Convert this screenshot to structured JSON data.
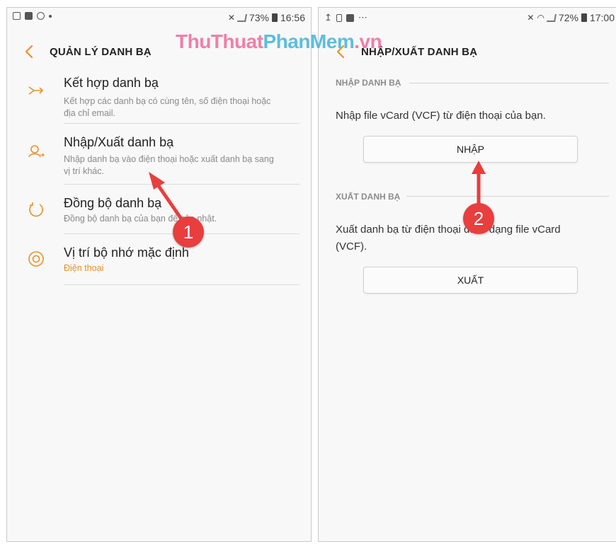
{
  "watermark": {
    "part1": "ThuThuat",
    "part2": "PhanMem",
    "part3": ".vn"
  },
  "left": {
    "status": {
      "battery": "73%",
      "time": "16:56"
    },
    "header": {
      "title": "QUẢN LÝ DANH BẠ",
      "back_icon": "chevron-left-icon"
    },
    "items": [
      {
        "title": "Kết hợp danh bạ",
        "desc": "Kết hợp các danh bạ có cùng tên, số điện thoại hoặc địa chỉ email.",
        "icon": "merge-icon"
      },
      {
        "title": "Nhập/Xuất danh bạ",
        "desc": "Nhập danh bạ vào điện thoại hoặc xuất danh bạ sang vị trí khác.",
        "icon": "import-export-icon"
      },
      {
        "title": "Đồng bộ danh bạ",
        "desc": "Đồng bộ danh bạ của bạn để cập nhật.",
        "icon": "sync-icon"
      },
      {
        "title": "Vị trí bộ nhớ mặc định",
        "desc": "Điện thoại",
        "icon": "storage-icon"
      }
    ]
  },
  "right": {
    "status": {
      "battery": "72%",
      "time": "17:00"
    },
    "header": {
      "title": "NHẬP/XUẤT DANH BẠ"
    },
    "import_section": {
      "label": "NHẬP DANH BẠ",
      "text": "Nhập file vCard (VCF) từ điện thoại của bạn.",
      "button": "NHẬP"
    },
    "export_section": {
      "label": "XUẤT DANH BẠ",
      "text": "Xuất danh bạ từ điện thoại dưới dạng file vCard (VCF).",
      "button": "XUẤT"
    }
  },
  "callouts": {
    "one": "1",
    "two": "2"
  },
  "colors": {
    "accent": "#e8912a",
    "callout": "#e83e3e",
    "watermark_pink": "#f06a9a",
    "watermark_blue": "#36b0d8"
  }
}
